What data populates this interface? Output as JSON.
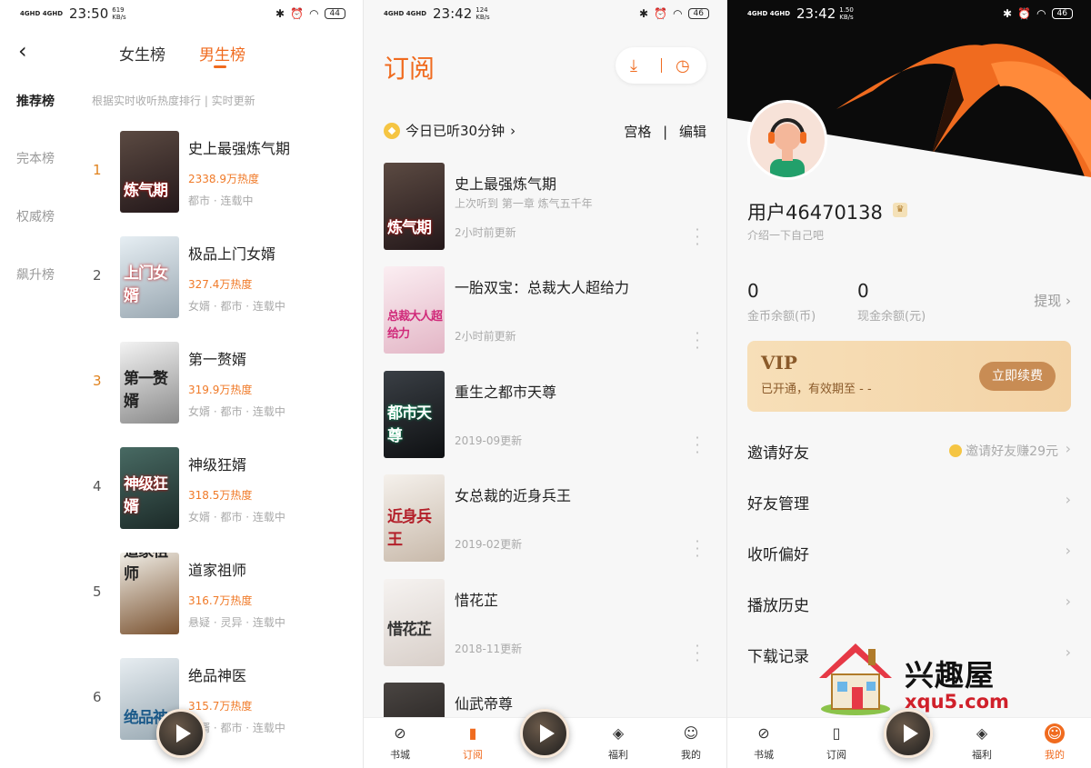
{
  "status_bars": [
    {
      "network": "4GHD 4GHD",
      "time": "23:50",
      "speed": "619 KB/s",
      "battery": "44"
    },
    {
      "network": "4GHD 4GHD",
      "time": "23:42",
      "speed": "124 KB/s",
      "battery": "46"
    },
    {
      "network": "4GHD 4GHD",
      "time": "23:42",
      "speed": "1.50 KB/s",
      "battery": "46"
    }
  ],
  "ranking": {
    "tabs": [
      "女生榜",
      "男生榜"
    ],
    "active_tab": "男生榜",
    "categories": [
      "推荐榜",
      "完本榜",
      "权威榜",
      "飙升榜"
    ],
    "active_category": "推荐榜",
    "hint": "根据实时收听热度排行 | 实时更新",
    "items": [
      {
        "rank": "1",
        "title": "史上最强炼气期",
        "heat": "2338.9万热度",
        "tags": "都市 · 连载中",
        "cover_text": "炼气期",
        "cover_bg": "#3a2a2a"
      },
      {
        "rank": "2",
        "title": "极品上门女婿",
        "heat": "327.4万热度",
        "tags": "女婿 · 都市 · 连载中",
        "cover_text": "上门女婿",
        "cover_bg": "#cfd6da"
      },
      {
        "rank": "3",
        "title": "第一赘婿",
        "heat": "319.9万热度",
        "tags": "女婿 · 都市 · 连载中",
        "cover_text": "第一赘婿",
        "cover_bg": "#e7e7e7"
      },
      {
        "rank": "4",
        "title": "神级狂婿",
        "heat": "318.5万热度",
        "tags": "女婿 · 都市 · 连载中",
        "cover_text": "神级狂婿",
        "cover_bg": "#2f4a44"
      },
      {
        "rank": "5",
        "title": "道家祖师",
        "heat": "316.7万热度",
        "tags": "悬疑 · 灵异 · 连载中",
        "cover_text": "道家祖师",
        "cover_bg": "#a8845a"
      },
      {
        "rank": "6",
        "title": "绝品神医",
        "heat": "315.7万热度",
        "tags": "女婿 · 都市 · 连载中",
        "cover_text": "绝品神",
        "cover_bg": "#c9d3d8"
      }
    ]
  },
  "subscribe": {
    "title": "订阅",
    "listened_today": "今日已听30分钟",
    "grid_label": "宫格",
    "edit_label": "编辑",
    "books": [
      {
        "title": "史上最强炼气期",
        "meta": "上次听到 第一章 炼气五千年",
        "update": "2小时前更新",
        "cover_text": "炼气期",
        "cover_bg": "#3a2a2a"
      },
      {
        "title": "一胎双宝：总裁大人超给力",
        "meta": "",
        "update": "2小时前更新",
        "cover_text": "总裁大人超给力",
        "cover_bg": "#f3dfe4"
      },
      {
        "title": "重生之都市天尊",
        "meta": "",
        "update": "2019-09更新",
        "cover_text": "都市天尊",
        "cover_bg": "#1e2226"
      },
      {
        "title": "女总裁的近身兵王",
        "meta": "",
        "update": "2019-02更新",
        "cover_text": "近身兵王",
        "cover_bg": "#ece7e1"
      },
      {
        "title": "惜花芷",
        "meta": "",
        "update": "2018-11更新",
        "cover_text": "惜花芷",
        "cover_bg": "#ede9e6"
      },
      {
        "title": "仙武帝尊",
        "meta": "",
        "update": "",
        "cover_text": "",
        "cover_bg": "#3a3634"
      }
    ]
  },
  "profile": {
    "username": "用户46470138",
    "intro": "介绍一下自己吧",
    "coins_value": "0",
    "coins_label": "金币余额(币)",
    "cash_value": "0",
    "cash_label": "现金余额(元)",
    "withdraw": "提现",
    "vip_title": "VIP",
    "vip_desc": "已开通，有效期至 - -",
    "vip_button": "立即续费",
    "menu": [
      {
        "label": "邀请好友",
        "right": "邀请好友赚29元"
      },
      {
        "label": "好友管理",
        "right": ""
      },
      {
        "label": "收听偏好",
        "right": ""
      },
      {
        "label": "播放历史",
        "right": ""
      },
      {
        "label": "下载记录",
        "right": ""
      }
    ]
  },
  "tabbar": {
    "tabs": [
      "书城",
      "订阅",
      "福利",
      "我的"
    ]
  },
  "watermark": {
    "name": "兴趣屋",
    "url": "xqu5.com"
  },
  "colors": {
    "accent": "#f06b1f",
    "heat": "#f07a28",
    "vip_bg": "#f7dfb8"
  }
}
